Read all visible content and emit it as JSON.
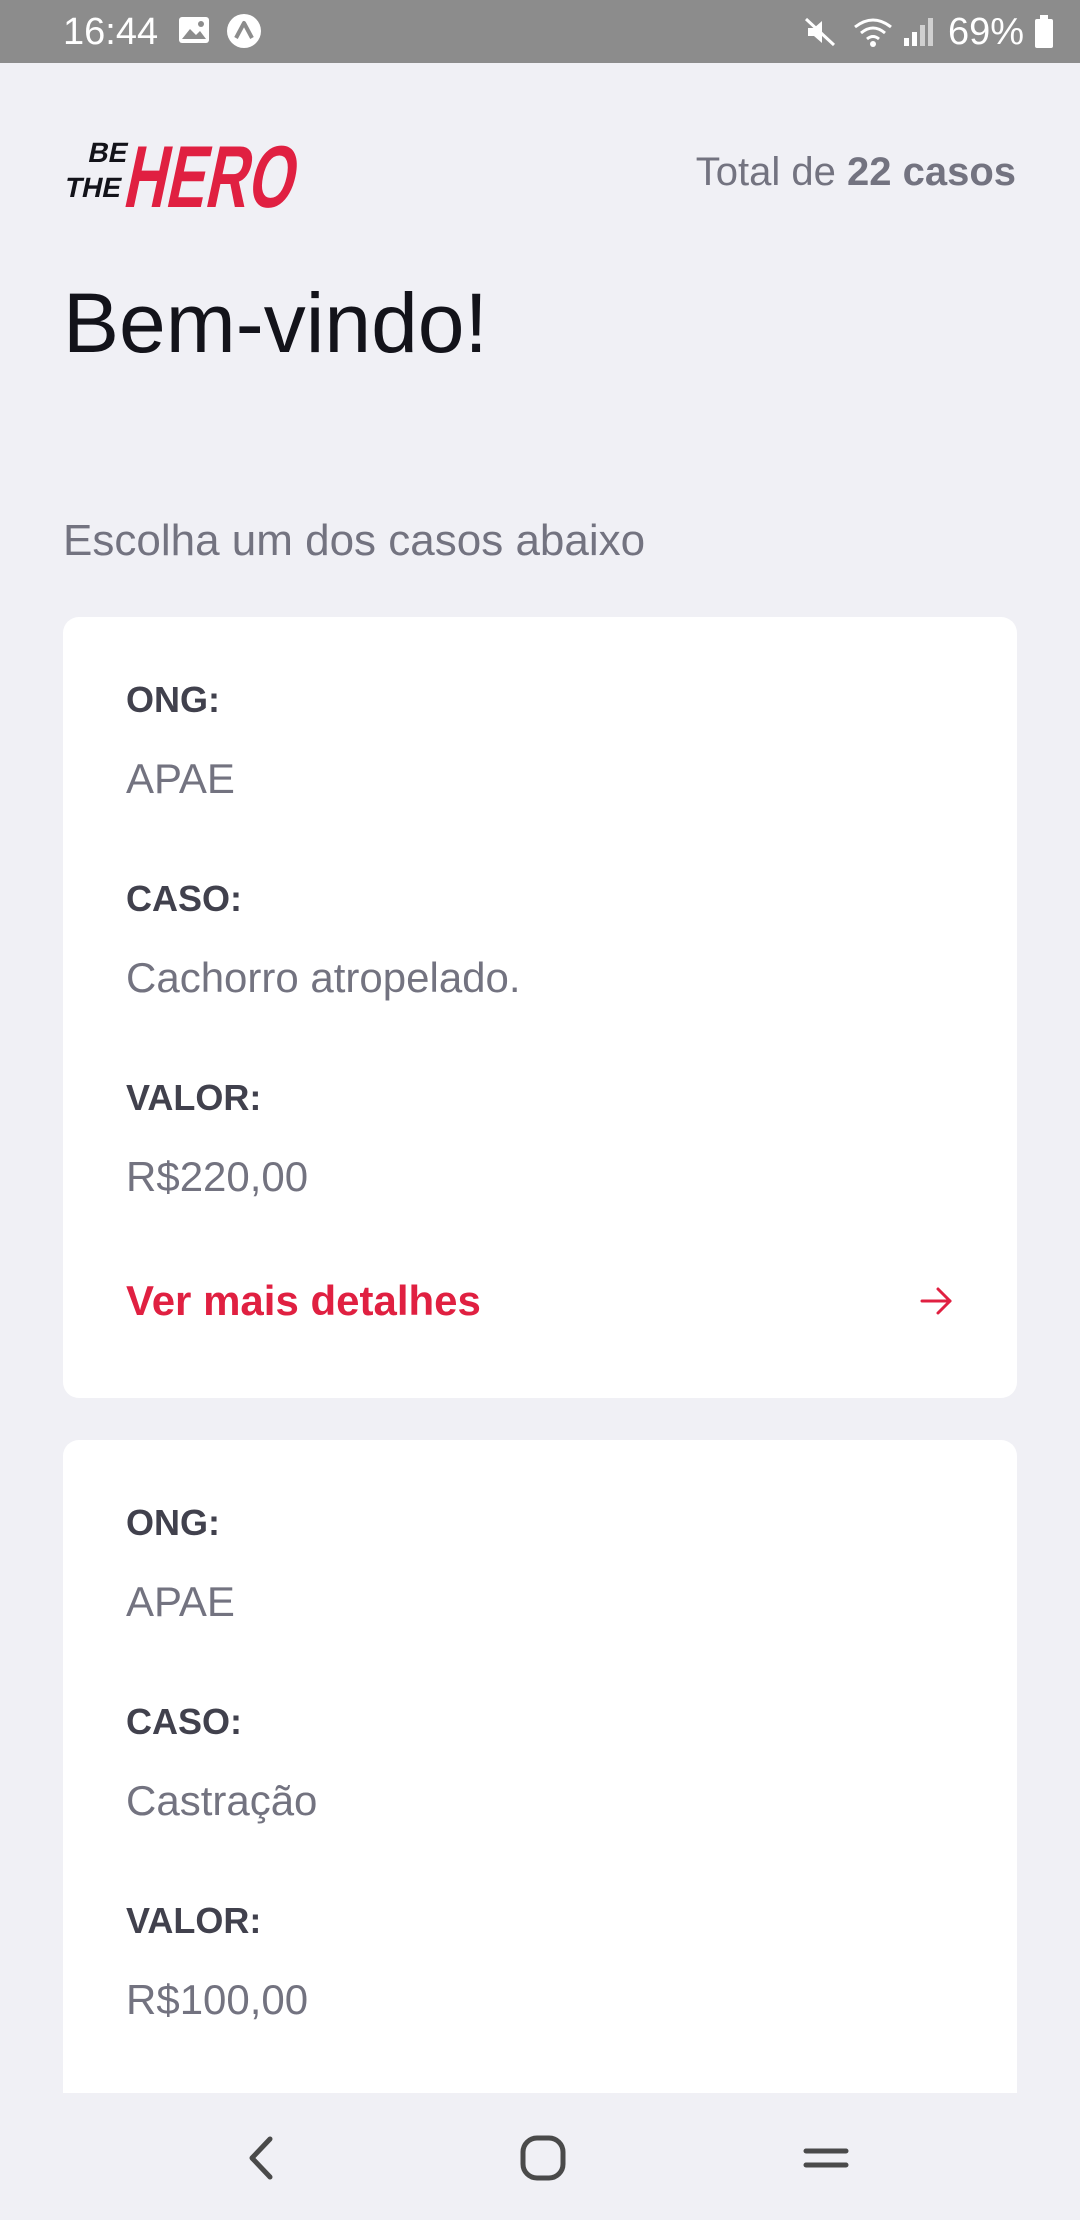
{
  "status_bar": {
    "time": "16:44",
    "battery": "69%",
    "icons": [
      "gallery-icon",
      "app-notification-icon",
      "mute-icon",
      "wifi-icon",
      "signal-icon",
      "battery-icon"
    ]
  },
  "header": {
    "logo_text": "BE THE HERO",
    "total_prefix": "Total de ",
    "total_count": "22 casos"
  },
  "welcome_title": "Bem-vindo!",
  "subtitle": "Escolha um dos casos abaixo",
  "cases": [
    {
      "ong_label": "ONG:",
      "ong": "APAE",
      "case_label": "CASO:",
      "case": "Cachorro atropelado.",
      "value_label": "VALOR:",
      "value": "R$220,00",
      "details_label": "Ver mais detalhes"
    },
    {
      "ong_label": "ONG:",
      "ong": "APAE",
      "case_label": "CASO:",
      "case": "Castração",
      "value_label": "VALOR:",
      "value": "R$100,00"
    }
  ],
  "nav": {
    "icons": [
      "back-icon",
      "home-icon",
      "recent-apps-icon"
    ]
  },
  "colors": {
    "accent": "#e02041",
    "background": "#f0f0f5",
    "card": "#ffffff",
    "text_dark": "#13131a",
    "text_muted": "#737380",
    "label": "#41414d",
    "status_bar": "#8c8c8c"
  }
}
